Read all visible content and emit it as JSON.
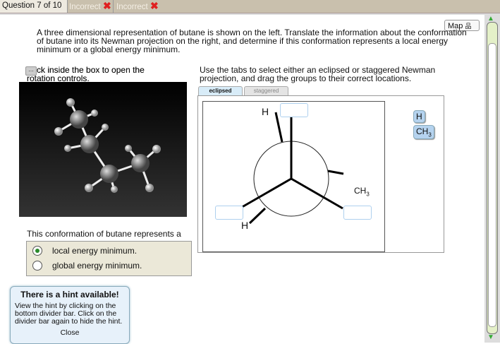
{
  "header": {
    "question": "Question 7 of 10",
    "attempts": [
      "Incorrect",
      "Incorrect"
    ]
  },
  "map_label": "Map",
  "prompt": "A three dimensional representation of butane is shown on the left. Translate the information about the conformation of butane into its Newman projection on the right, and determine if this conformation represents a local energy minimum or a global energy minimum.",
  "left_instruction": "Click inside the box to open the rotation controls.",
  "left_instruction_visible": "ck inside the box to open the",
  "left_instruction_line2": "rotation controls.",
  "right_instruction": "Use the tabs to select either an eclipsed or staggered Newman projection, and drag the groups to their correct locations.",
  "tabs": [
    "eclipsed",
    "staggered"
  ],
  "newman": {
    "labels": {
      "h_top": "H",
      "h_bottom": "H",
      "ch3": "CH3"
    }
  },
  "chips": [
    "H",
    "CH3"
  ],
  "question_text": "This conformation of butane represents a",
  "options": [
    {
      "label": "local energy minimum.",
      "selected": true
    },
    {
      "label": "global energy minimum.",
      "selected": false
    }
  ],
  "hint": {
    "title": "There is a hint available!",
    "body": "View the hint by clicking on the bottom divider bar. Click on the divider bar again to hide the hint.",
    "close": "Close"
  }
}
